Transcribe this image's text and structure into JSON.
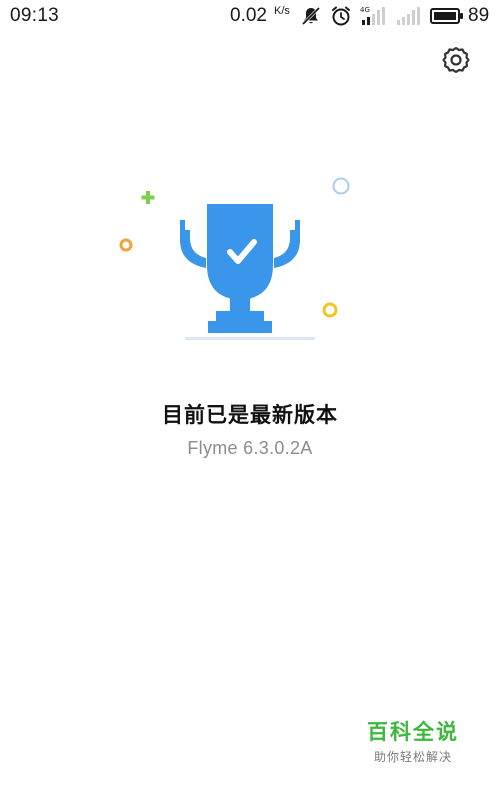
{
  "status_bar": {
    "time": "09:13",
    "net_speed": "0.02",
    "net_speed_unit": "K/s",
    "battery": "89",
    "icons": [
      "mute-icon",
      "alarm-icon",
      "signal-4g-icon",
      "signal-icon",
      "battery-icon"
    ]
  },
  "header": {
    "settings_icon": "gear-icon"
  },
  "main": {
    "title": "目前已是最新版本",
    "version": "Flyme 6.3.0.2A"
  },
  "colors": {
    "trophy_blue": "#3a96ea",
    "green_plus": "#7bd14e",
    "orange_dot": "#f2a23a",
    "yellow_dot": "#f5c521",
    "light_blue_ring": "#a9cdf0",
    "watermark_green": "#3cb93c"
  },
  "watermark": {
    "title": "百科全说",
    "subtitle": "助你轻松解决"
  }
}
